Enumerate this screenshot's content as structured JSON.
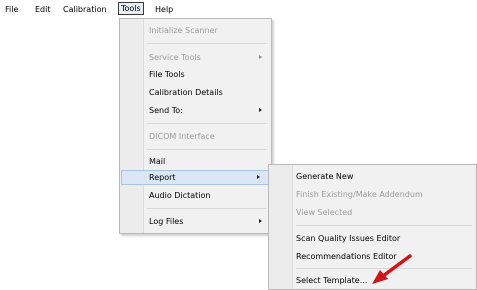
{
  "menubar": {
    "items": [
      {
        "label": "File"
      },
      {
        "label": "Edit"
      },
      {
        "label": "Calibration"
      },
      {
        "label": "Tools"
      },
      {
        "label": "Help"
      }
    ]
  },
  "tools_menu": {
    "items": [
      {
        "label": "Initialize Scanner",
        "disabled": true
      },
      {
        "label": "Service Tools",
        "disabled": true,
        "submenu": true
      },
      {
        "label": "File Tools"
      },
      {
        "label": "Calibration Details"
      },
      {
        "label": "Send To:",
        "submenu": true
      },
      {
        "label": "DICOM Interface",
        "disabled": true
      },
      {
        "label": "Mail"
      },
      {
        "label": "Report",
        "submenu": true,
        "highlighted": true
      },
      {
        "label": "Audio Dictation"
      },
      {
        "label": "Log Files",
        "submenu": true
      }
    ]
  },
  "report_submenu": {
    "items": [
      {
        "label": "Generate New"
      },
      {
        "label": "Finish Existing/Make Addendum",
        "disabled": true
      },
      {
        "label": "View Selected",
        "disabled": true
      },
      {
        "label": "Scan Quality Issues Editor"
      },
      {
        "label": "Recommendations Editor"
      },
      {
        "label": "Select Template..."
      }
    ]
  },
  "colors": {
    "annotation_arrow": "#d0141c",
    "highlight": "#dbe7f7"
  },
  "icons": {
    "submenu_indicator": "chevron-right-icon",
    "annotation": "red-arrow-annotation"
  }
}
